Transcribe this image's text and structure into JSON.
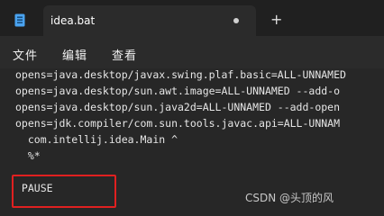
{
  "window": {
    "tab_title": "idea.bat",
    "app_icon": "notepad-file-icon"
  },
  "toolbar": {
    "new_tab_label": "+"
  },
  "menu": {
    "items": [
      "文件",
      "编辑",
      "查看"
    ]
  },
  "editor": {
    "lines": [
      "opens=java.desktop/javax.swing.plaf.basic=ALL-UNNAMED",
      "opens=java.desktop/sun.awt.image=ALL-UNNAMED --add-o",
      "opens=java.desktop/sun.java2d=ALL-UNNAMED --add-open",
      "opens=jdk.compiler/com.sun.tools.javac.api=ALL-UNNAM",
      "  com.intellij.idea.Main ^",
      "  %*",
      "",
      " PAUSE"
    ]
  },
  "watermark": "CSDN @头顶的风",
  "colors": {
    "highlight": "#e02020",
    "background": "#272727"
  }
}
